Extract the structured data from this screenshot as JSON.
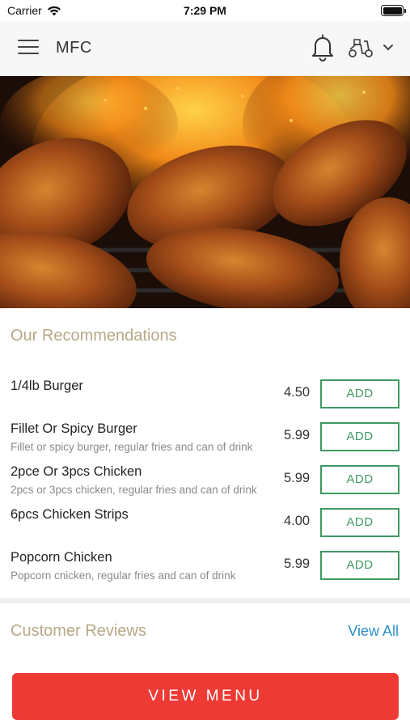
{
  "status_bar": {
    "carrier": "Carrier",
    "time": "7:29 PM"
  },
  "header": {
    "title": "MFC",
    "menu_icon": "hamburger-icon",
    "notification_icon": "bell-icon",
    "delivery_icon": "scooter-icon",
    "dropdown_icon": "chevron-down-icon"
  },
  "hero": {
    "image": "grilled-chicken-wings-photo"
  },
  "recommendations": {
    "title": "Our Recommendations",
    "items": [
      {
        "name": "1/4lb Burger",
        "description": "",
        "price": "4.50",
        "add_label": "ADD"
      },
      {
        "name": "Fillet Or Spicy Burger",
        "description": "Fillet or spicy burger, regular fries and can of drink",
        "price": "5.99",
        "add_label": "ADD"
      },
      {
        "name": "2pce Or 3pcs Chicken",
        "description": "2pcs or 3pcs chicken, regular fries and can of drink",
        "price": "5.99",
        "add_label": "ADD"
      },
      {
        "name": "6pcs Chicken Strips",
        "description": "",
        "price": "4.00",
        "add_label": "ADD"
      },
      {
        "name": "Popcorn Chicken",
        "description": "Popcorn cnicken, regular fries and can of drink",
        "price": "5.99",
        "add_label": "ADD"
      }
    ]
  },
  "reviews": {
    "title": "Customer Reviews",
    "view_all_label": "View All"
  },
  "footer": {
    "view_menu_label": "VIEW MENU"
  },
  "colors": {
    "accent_red": "#ee3a35",
    "add_green": "#3f9a63",
    "section_title": "#b7a887",
    "link_blue": "#2d8fc9"
  }
}
